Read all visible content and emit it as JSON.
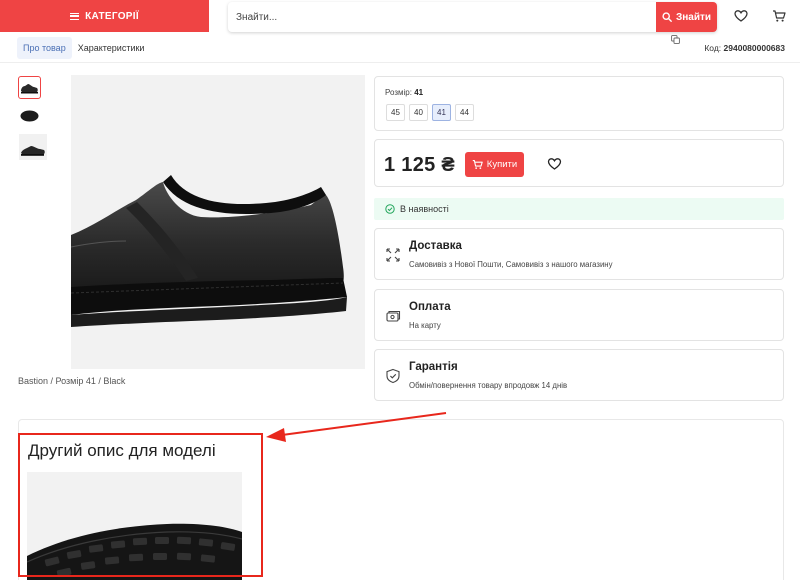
{
  "header": {
    "categories_label": "КАТЕГОРІЇ",
    "search_placeholder": "Знайти...",
    "search_button": "Знайти"
  },
  "tabs": [
    {
      "label": "Про товар",
      "active": true
    },
    {
      "label": "Характеристики",
      "active": false
    }
  ],
  "product": {
    "code_label": "Код:",
    "code_value": "2940080000683",
    "caption": "Bastion / Розмір 41 / Black",
    "size_label": "Розмір:",
    "size_value": "41",
    "sizes": [
      "45",
      "40",
      "41",
      "44"
    ],
    "selected_size": "41",
    "price": "1 125 ₴",
    "buy_label": "Купити",
    "stock": "В наявності"
  },
  "info": {
    "delivery": {
      "title": "Доставка",
      "subtitle": "Самовивіз з Нової Пошти, Самовивіз з нашого магазину"
    },
    "payment": {
      "title": "Оплата",
      "subtitle": "На карту"
    },
    "warranty": {
      "title": "Гарантія",
      "subtitle": "Обмін/повернення товару впродовж 14 днів"
    }
  },
  "description": {
    "title": "Другий опис для моделі"
  },
  "colors": {
    "accent": "#ef4444",
    "annotation": "#e8271c",
    "stock_bg": "#ecfbf3",
    "stock_icon": "#22a55b"
  },
  "icons": {
    "header": [
      "menu-icon",
      "search-icon",
      "heart-icon",
      "cart-icon"
    ],
    "info": [
      "delivery-icon",
      "payment-icon",
      "warranty-icon"
    ]
  }
}
